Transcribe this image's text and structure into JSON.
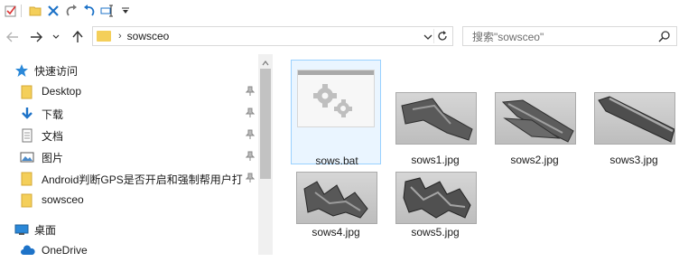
{
  "toolbar": {
    "icons": [
      "checkmark-icon",
      "folder-icon",
      "delete-icon",
      "redo-icon",
      "undo-icon",
      "rename-icon",
      "customize-dropdown-icon"
    ]
  },
  "address": {
    "path": "sowsceo"
  },
  "search": {
    "placeholder": "搜索\"sowsceo\""
  },
  "nav_pane": {
    "items": [
      {
        "label": "快速访问",
        "icon": "star-icon"
      },
      {
        "label": "Desktop",
        "icon": "folder-icon",
        "pinned": true
      },
      {
        "label": "下载",
        "icon": "download-icon",
        "pinned": true
      },
      {
        "label": "文档",
        "icon": "document-icon",
        "pinned": true
      },
      {
        "label": "图片",
        "icon": "picture-icon",
        "pinned": true
      },
      {
        "label": "Android判断GPS是否开启和强制帮用户打",
        "icon": "folder-icon",
        "pinned": true
      },
      {
        "label": "sowsceo",
        "icon": "folder-icon"
      },
      {
        "label": "桌面",
        "icon": "desktop-icon"
      },
      {
        "label": "OneDrive",
        "icon": "cloud-icon"
      }
    ]
  },
  "files": [
    {
      "name": "sows.bat",
      "type": "bat",
      "selected": true
    },
    {
      "name": "sows1.jpg",
      "type": "jpg"
    },
    {
      "name": "sows2.jpg",
      "type": "jpg"
    },
    {
      "name": "sows3.jpg",
      "type": "jpg"
    },
    {
      "name": "sows4.jpg",
      "type": "jpg"
    },
    {
      "name": "sows5.jpg",
      "type": "jpg"
    }
  ],
  "colors": {
    "selection_fill": "#eaf5ff",
    "selection_border": "#99d1ff",
    "folder": "#f4cf5a",
    "accent": "#1e73c8"
  }
}
